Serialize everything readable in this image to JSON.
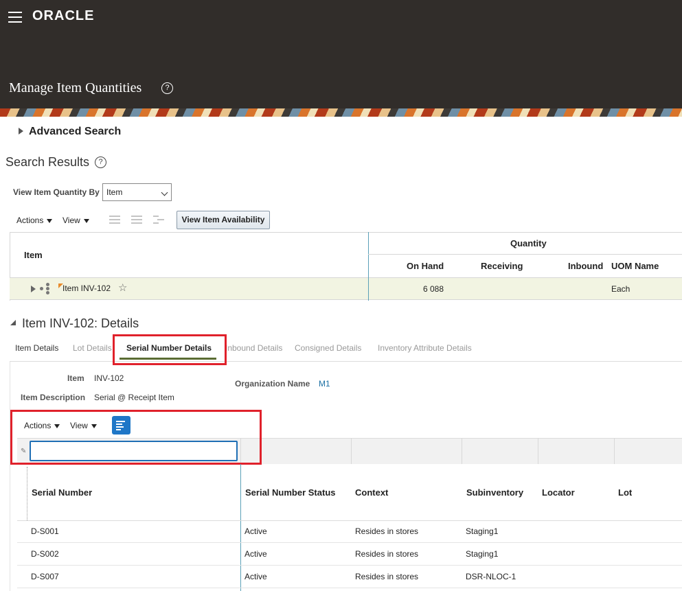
{
  "header": {
    "logo": "ORACLE",
    "page_title": "Manage Item Quantities",
    "help_glyph": "?"
  },
  "advanced_search": {
    "label": "Advanced Search"
  },
  "search_results": {
    "title": "Search Results",
    "view_by_label": "View Item Quantity By",
    "view_by_value": "Item",
    "toolbar": {
      "actions": "Actions",
      "view": "View",
      "view_availability": "View Item Availability"
    },
    "table": {
      "item_header": "Item",
      "quantity_group": "Quantity",
      "columns": [
        "On Hand",
        "Receiving",
        "Inbound",
        "UOM Name"
      ],
      "rows": [
        {
          "item": "Item INV-102",
          "on_hand": "6 088",
          "receiving": "",
          "inbound": "",
          "uom": "Each"
        }
      ]
    }
  },
  "details": {
    "title": "Item INV-102: Details",
    "tabs": [
      "Item Details",
      "Lot Details",
      "Serial Number Details",
      "Inbound Details",
      "Consigned Details",
      "Inventory Attribute Details"
    ],
    "active_tab": "Serial Number Details",
    "fields": {
      "item_label": "Item",
      "item_value": "INV-102",
      "desc_label": "Item Description",
      "desc_value": "Serial @ Receipt Item",
      "org_label": "Organization Name",
      "org_value": "M1"
    },
    "toolbar": {
      "actions": "Actions",
      "view": "View"
    },
    "filter_input": {
      "value": "",
      "placeholder": ""
    },
    "table": {
      "columns": [
        "Serial Number",
        "Serial Number Status",
        "Context",
        "Subinventory",
        "Locator",
        "Lot"
      ],
      "rows": [
        {
          "serial": "D-S001",
          "status": "Active",
          "context": "Resides in stores",
          "subinventory": "Staging1",
          "locator": "",
          "lot": ""
        },
        {
          "serial": "D-S002",
          "status": "Active",
          "context": "Resides in stores",
          "subinventory": "Staging1",
          "locator": "",
          "lot": ""
        },
        {
          "serial": "D-S007",
          "status": "Active",
          "context": "Resides in stores",
          "subinventory": "DSR-NLOC-1",
          "locator": "",
          "lot": ""
        }
      ]
    }
  },
  "colors": {
    "header_bg": "#312d2a",
    "highlight_red": "#e0212b",
    "link_blue": "#1a6fa3",
    "active_tab_underline": "#5b6d34"
  },
  "icons": [
    "menu-icon",
    "help-icon",
    "expand-icon",
    "filter-icon",
    "favorite-star-icon",
    "hierarchy-icon"
  ]
}
